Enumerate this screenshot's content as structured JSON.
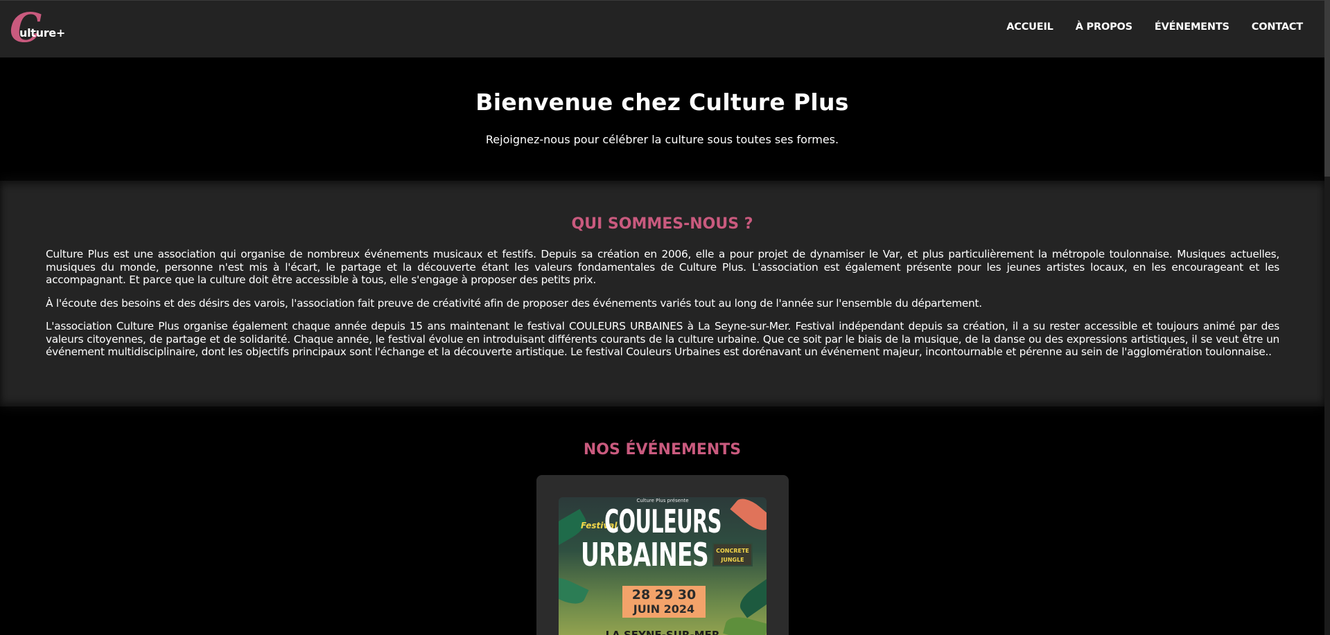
{
  "header": {
    "logo_letter": "C",
    "logo_text": "ulture+",
    "nav": [
      {
        "label": "ACCUEIL"
      },
      {
        "label": "À PROPOS"
      },
      {
        "label": "ÉVÉNEMENTS"
      },
      {
        "label": "CONTACT"
      }
    ]
  },
  "hero": {
    "title": "Bienvenue chez Culture Plus",
    "subtitle": "Rejoignez-nous pour célébrer la culture sous toutes ses formes."
  },
  "about": {
    "heading": "QUI SOMMES-NOUS ?",
    "paragraphs": [
      "Culture Plus est une association qui organise de nombreux événements musicaux et festifs. Depuis sa création en 2006, elle a pour projet de dynamiser le Var, et plus particulièrement la métropole toulonnaise. Musiques actuelles, musiques du monde, personne n'est mis à l'écart, le partage et la découverte étant les valeurs fondamentales de Culture Plus. L'association est également présente pour les jeunes artistes locaux, en les encourageant et les accompagnant. Et parce que la culture doit être accessible à tous, elle s'engage à proposer des petits prix.",
      "À l'écoute des besoins et des désirs des varois, l'association fait preuve de créativité afin de proposer des événements variés tout au long de l'année sur l'ensemble du département.",
      "L'association Culture Plus organise également chaque année depuis 15 ans maintenant le festival COULEURS URBAINES à La Seyne-sur-Mer. Festival indépendant depuis sa création, il a su rester accessible et toujours animé par des valeurs citoyennes, de partage et de solidarité. Chaque année, le festival évolue en introduisant différents courants de la culture urbaine. Que ce soit par le biais de la musique, de la danse ou des expressions artistiques, il se veut être un événement multidisciplinaire, dont les objectifs principaux sont l'échange et la découverte artistique. Le festival Couleurs Urbaines est dorénavant un événement majeur, incontournable et pérenne au sein de l'agglomération toulonnaise.."
    ]
  },
  "events": {
    "heading": "NOS ÉVÉNEMENTS",
    "poster": {
      "top_line": "Culture Plus présente",
      "festival_label": "Festival",
      "title_line1": "COULEURS",
      "title_line2": "URBAINES",
      "badge": "CONCRETE JUNGLE",
      "dates": "28 29 30",
      "month_year": "JUIN 2024",
      "city": "LA SEYNE-SUR-MER"
    }
  }
}
